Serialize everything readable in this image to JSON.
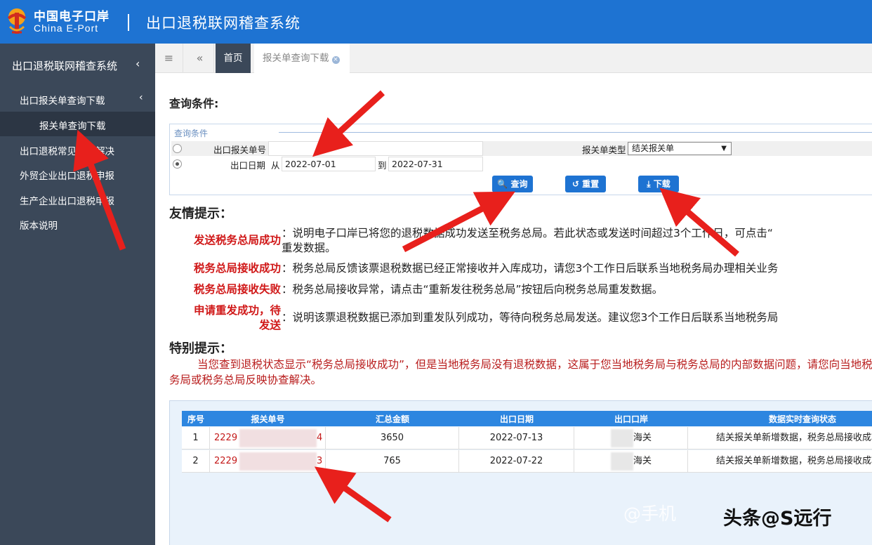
{
  "header": {
    "brand_cn": "中国电子口岸",
    "brand_en": "China E-Port",
    "system_title": "出口退税联网稽查系统"
  },
  "sidebar": {
    "head": "出口退税联网稽查系统",
    "items": [
      {
        "label": "出口报关单查询下载"
      },
      {
        "label": "报关单查询下载"
      },
      {
        "label": "出口退税常见问题解决"
      },
      {
        "label": "外贸企业出口退税申报"
      },
      {
        "label": "生产企业出口退税申报"
      },
      {
        "label": "版本说明"
      }
    ]
  },
  "tabs": {
    "home": "首页",
    "active": "报关单查询下载"
  },
  "query": {
    "title": "查询条件:",
    "legend": "查询条件",
    "declaration_no_label": "出口报关单号",
    "declaration_no_value": "",
    "type_label": "报关单类型",
    "type_value": "结关报关单",
    "date_label": "出口日期",
    "from_label": "从",
    "from_value": "2022-07-01",
    "to_label": "到",
    "to_value": "2022-07-31",
    "btn_query": "查询",
    "btn_reset": "重置",
    "btn_download": "下载"
  },
  "tips": {
    "title": "友情提示：",
    "items": [
      {
        "key": "发送税务总局成功",
        "text": "：说明电子口岸已将您的退税数据成功发送至税务总局。若此状态或发送时间超过3个工作日，可点击“",
        "text2": "重发数据。"
      },
      {
        "key": "税务总局接收成功",
        "text": "：税务总局反馈该票退税数据已经正常接收并入库成功，请您3个工作日后联系当地税务局办理相关业务"
      },
      {
        "key": "税务总局接收失败",
        "text": "：税务总局接收异常，请点击“重新发往税务总局”按钮后向税务总局重发数据。"
      },
      {
        "key": "申请重发成功，待",
        "key2": "发送",
        "text": "：说明该票退税数据已添加到重发队列成功，等待向税务总局发送。建议您3个工作日后联系当地税务局"
      }
    ]
  },
  "special": {
    "title": "特别提示：",
    "text": "当您查到退税状态显示“税务总局接收成功”，但是当地税务局没有退税数据，这属于您当地税务局与税务总局的内部数据问题，请您向当地税务局或税务总局反映协查解决。"
  },
  "table": {
    "headers": [
      "序号",
      "报关单号",
      "汇总金额",
      "出口日期",
      "出口口岸",
      "数据实时查询状态"
    ],
    "rows": [
      {
        "no": "1",
        "id_start": "2229",
        "id_end": "4",
        "amount": "3650",
        "date": "2022-07-13",
        "port": "海关",
        "status": "结关报关单新增数据，税务总局接收成功"
      },
      {
        "no": "2",
        "id_start": "2229",
        "id_end": "3",
        "amount": "765",
        "date": "2022-07-22",
        "port": "海关",
        "status": "结关报关单新增数据，税务总局接收成功"
      }
    ]
  },
  "watermark": {
    "faded": "@手机",
    "main": "头条@S远行"
  },
  "colors": {
    "header_blue": "#1e73d2",
    "sidebar": "#3b4859",
    "tip_red": "#d01818",
    "arrow_red": "#e8201c"
  }
}
